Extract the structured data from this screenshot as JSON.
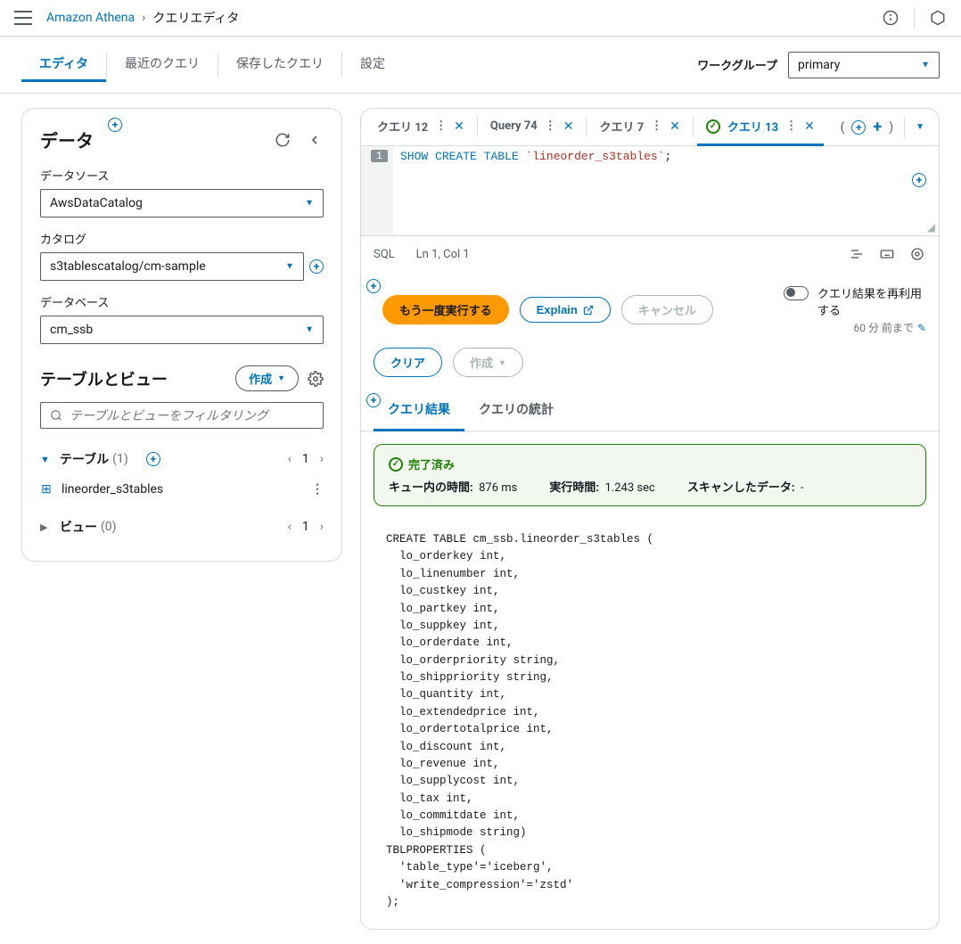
{
  "breadcrumb": {
    "service": "Amazon Athena",
    "page": "クエリエディタ"
  },
  "main_tabs": {
    "editor": "エディタ",
    "recent": "最近のクエリ",
    "saved": "保存したクエリ",
    "settings": "設定"
  },
  "workgroup": {
    "label": "ワークグループ",
    "value": "primary"
  },
  "left": {
    "title": "データ",
    "datasource_label": "データソース",
    "datasource_value": "AwsDataCatalog",
    "catalog_label": "カタログ",
    "catalog_value": "s3tablescatalog/cm-sample",
    "database_label": "データベース",
    "database_value": "cm_ssb",
    "tv_title": "テーブルとビュー",
    "create_btn": "作成",
    "filter_placeholder": "テーブルとビューをフィルタリング",
    "tables_label": "テーブル",
    "tables_count": "(1)",
    "tables_page": "1",
    "table_item": "lineorder_s3tables",
    "views_label": "ビュー",
    "views_count": "(0)",
    "views_page": "1"
  },
  "query_tabs": {
    "t1": "クエリ 12",
    "t2": "Query 74",
    "t3": "クエリ 7",
    "t4": "クエリ 13",
    "paren_open": "(",
    "paren_close": ")"
  },
  "editor": {
    "line_no": "1",
    "kw1": "SHOW",
    "kw2": "CREATE",
    "kw3": "TABLE",
    "tbl": "`lineorder_s3tables`",
    "semi": ";",
    "lang": "SQL",
    "pos": "Ln 1, Col 1"
  },
  "actions": {
    "run": "もう一度実行する",
    "explain": "Explain",
    "cancel": "キャンセル",
    "clear": "クリア",
    "create": "作成",
    "reuse": "クエリ結果を再利用する",
    "reuse_sub": "60 分 前まで"
  },
  "result_tabs": {
    "results": "クエリ結果",
    "stats": "クエリの統計"
  },
  "status": {
    "done": "完了済み",
    "queue_label": "キュー内の時間:",
    "queue_val": "876 ms",
    "exec_label": "実行時間:",
    "exec_val": "1.243 sec",
    "scan_label": "スキャンしたデータ:",
    "scan_val": "-"
  },
  "result_sql": "CREATE TABLE cm_ssb.lineorder_s3tables (\n  lo_orderkey int,\n  lo_linenumber int,\n  lo_custkey int,\n  lo_partkey int,\n  lo_suppkey int,\n  lo_orderdate int,\n  lo_orderpriority string,\n  lo_shippriority string,\n  lo_quantity int,\n  lo_extendedprice int,\n  lo_ordertotalprice int,\n  lo_discount int,\n  lo_revenue int,\n  lo_supplycost int,\n  lo_tax int,\n  lo_commitdate int,\n  lo_shipmode string)\nTBLPROPERTIES (\n  'table_type'='iceberg',\n  'write_compression'='zstd'\n);"
}
